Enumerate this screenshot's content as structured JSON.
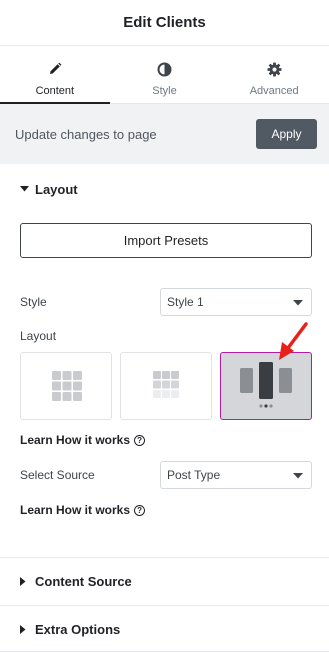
{
  "header": {
    "title": "Edit Clients"
  },
  "tabs": [
    {
      "label": "Content",
      "icon": "pencil-icon",
      "active": true
    },
    {
      "label": "Style",
      "icon": "contrast-icon",
      "active": false
    },
    {
      "label": "Advanced",
      "icon": "gear-icon",
      "active": false
    }
  ],
  "apply_bar": {
    "text": "Update changes to page",
    "button_label": "Apply"
  },
  "layout_section": {
    "title": "Layout",
    "import_label": "Import Presets",
    "style_label": "Style",
    "style_value": "Style 1",
    "layout_label": "Layout",
    "layout_options": [
      "grid-layout",
      "fading-grid-layout",
      "carousel-layout"
    ],
    "selected_layout": 2,
    "learn_1": "Learn How it works",
    "source_label": "Select Source",
    "source_value": "Post Type",
    "learn_2": "Learn How it works"
  },
  "collapsed_sections": [
    "Content Source",
    "Extra Options"
  ],
  "colors": {
    "accent_border": "#b01aa6",
    "arrow": "#e8201a",
    "button_dark": "#515962"
  }
}
